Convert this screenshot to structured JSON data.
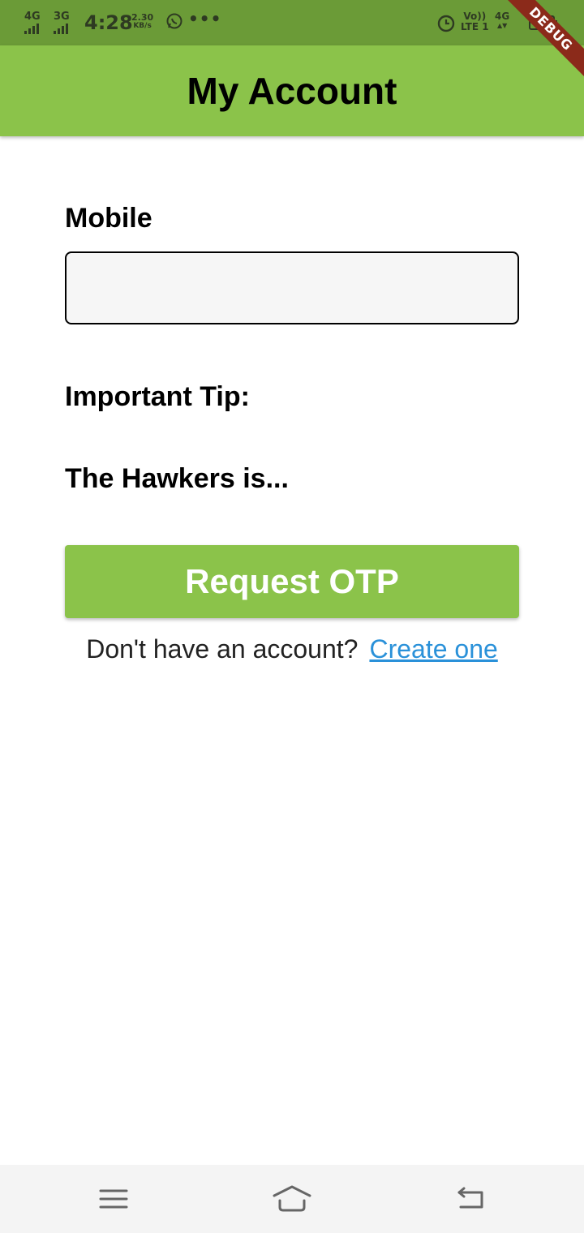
{
  "status_bar": {
    "network_left": "4G",
    "network_second": "3G",
    "time": "4:28",
    "speed_value": "2.30",
    "speed_unit": "KB/s",
    "more": "•••",
    "volte_top": "Vo))",
    "volte_bottom": "LTE 1",
    "network_right": "4G",
    "network_right_arrows": "▲▼",
    "icons": [
      "signal-icon",
      "whatsapp-icon",
      "alarm-icon",
      "battery-icon"
    ]
  },
  "debug_banner": "DEBUG",
  "app_bar": {
    "title": "My Account",
    "color": "#8bc34a"
  },
  "form": {
    "mobile_label": "Mobile",
    "mobile_value": "",
    "tip_label": "Important Tip:",
    "tip_text": "The Hawkers is...",
    "request_button": "Request OTP",
    "signup_prompt": "Don't have an account?",
    "signup_link": "Create one"
  },
  "colors": {
    "accent": "#8bc34a",
    "status_bar": "#6b9b37",
    "link": "#2a91d9",
    "debug": "#8b2a1a"
  },
  "nav_bar": {
    "icons": [
      "menu-icon",
      "home-icon",
      "back-icon"
    ]
  }
}
